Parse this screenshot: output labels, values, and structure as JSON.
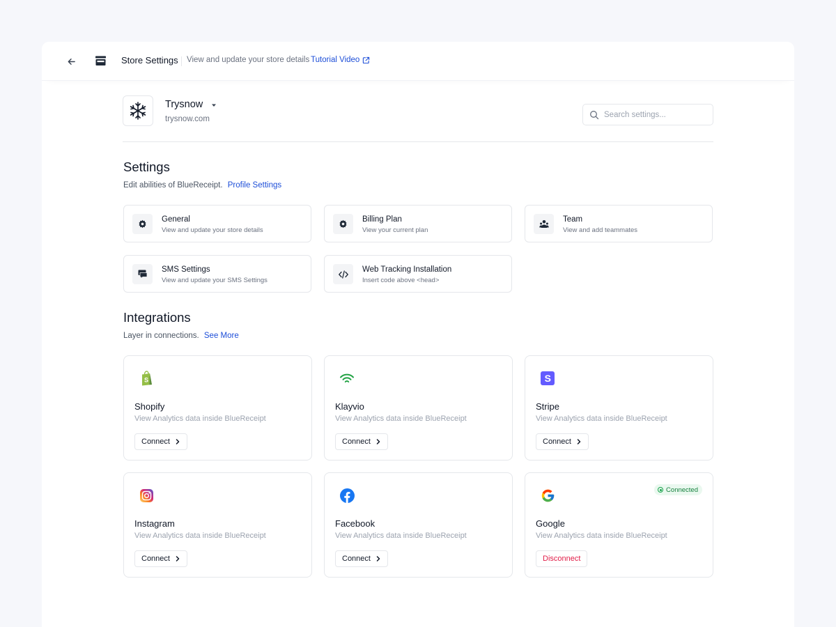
{
  "header": {
    "title": "Store Settings",
    "subtitle": "View and update your store details",
    "tutorial_link": "Tutorial Video"
  },
  "store": {
    "name": "Trysnow",
    "domain": "trysnow.com"
  },
  "search": {
    "placeholder": "Search settings..."
  },
  "settings": {
    "title": "Settings",
    "description": "Edit abilities of BlueReceipt.",
    "link": "Profile Settings",
    "cards": [
      {
        "title": "General",
        "description": "View and update your store details",
        "icon": "gear-icon"
      },
      {
        "title": "Billing Plan",
        "description": "View your current plan",
        "icon": "gear-icon"
      },
      {
        "title": "Team",
        "description": "View and add teammates",
        "icon": "team-icon"
      },
      {
        "title": "SMS Settings",
        "description": "View and update your SMS Settings",
        "icon": "chat-icon"
      },
      {
        "title": "Web Tracking Installation",
        "description": "Insert code above <head>",
        "icon": "code-icon"
      }
    ]
  },
  "integrations": {
    "title": "Integrations",
    "description": "Layer in connections.",
    "link": "See More",
    "items": [
      {
        "name": "Shopify",
        "description": "View Analytics data inside BlueReceipt",
        "action": "Connect",
        "icon": "shopify-logo"
      },
      {
        "name": "Klayvio",
        "description": "View Analytics data inside BlueReceipt",
        "action": "Connect",
        "icon": "klaviyo-logo"
      },
      {
        "name": "Stripe",
        "description": "View Analytics data inside BlueReceipt",
        "action": "Connect",
        "icon": "stripe-logo"
      },
      {
        "name": "Instagram",
        "description": "View Analytics data inside BlueReceipt",
        "action": "Connect",
        "icon": "instagram-logo"
      },
      {
        "name": "Facebook",
        "description": "View Analytics data inside BlueReceipt",
        "action": "Connect",
        "icon": "facebook-logo"
      },
      {
        "name": "Google",
        "description": "View Analytics data inside BlueReceipt",
        "action": "Disconnect",
        "icon": "google-logo",
        "status": "Connected"
      }
    ]
  },
  "colors": {
    "accent": "#1d4ed8",
    "danger": "#e11d48",
    "success": "#16a34a"
  }
}
